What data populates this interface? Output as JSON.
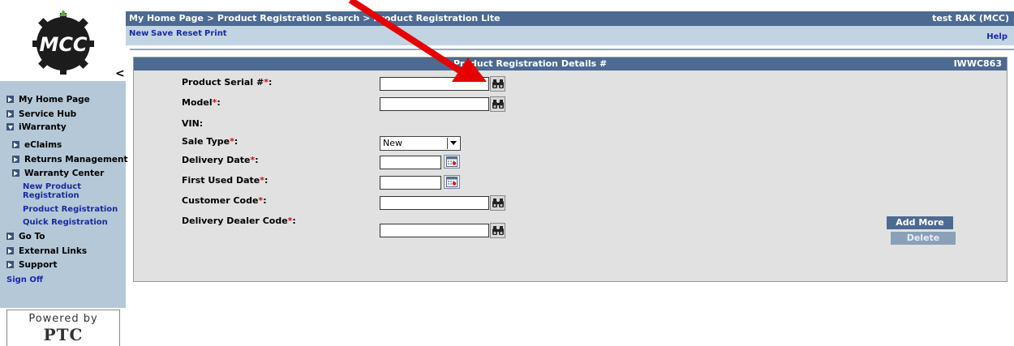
{
  "sidebar": {
    "logo_text": "MCC",
    "collapse_glyph": "<",
    "items": [
      {
        "label": "My Home Page"
      },
      {
        "label": "Service Hub"
      },
      {
        "label": "iWarranty"
      },
      {
        "label": "eClaims"
      },
      {
        "label": "Returns Management"
      },
      {
        "label": "Warranty Center"
      },
      {
        "label": "New Product Registration"
      },
      {
        "label": "Product Registration"
      },
      {
        "label": "Quick Registration"
      },
      {
        "label": "Go To"
      },
      {
        "label": "External Links"
      },
      {
        "label": "Support"
      },
      {
        "label": "Sign Off"
      }
    ],
    "new_product_line1": "New Product",
    "new_product_line2": "Registration",
    "powered_by": "Powered by",
    "ptc": "PTC"
  },
  "header": {
    "breadcrumb": [
      "My Home Page",
      ">",
      "Product Registration Search",
      ">",
      "Product Registration Lite"
    ],
    "user": "test RAK (MCC)"
  },
  "toolbar": {
    "new_label": "New",
    "save_label": "Save",
    "reset_label": "Reset",
    "print_label": "Print",
    "help_label": "Help"
  },
  "panel": {
    "title": "Product Registration Details #",
    "id": "IWWC863",
    "fields": {
      "serial": {
        "label": "Product Serial #",
        "value": ""
      },
      "model": {
        "label": "Model",
        "value": ""
      },
      "vin": {
        "label": "VIN:"
      },
      "sale_type": {
        "label": "Sale Type",
        "value": "New"
      },
      "delivery_date": {
        "label": "Delivery Date",
        "value": ""
      },
      "first_used": {
        "label": "First Used Date",
        "value": ""
      },
      "customer_code": {
        "label": "Customer Code",
        "value": ""
      },
      "dealer_code": {
        "label": "Delivery Dealer Code",
        "value": ""
      }
    },
    "required_mark": "*",
    "colon": ":",
    "add_more_label": "Add More",
    "delete_label": "Delete"
  },
  "colors": {
    "header_bar": "#4c6a92",
    "toolbar": "#c2d4e2",
    "sidebar_nav": "#b4c8d8",
    "panel_bg": "#e1e1e1",
    "required": "#d01010",
    "annotation_arrow": "#e60000"
  }
}
